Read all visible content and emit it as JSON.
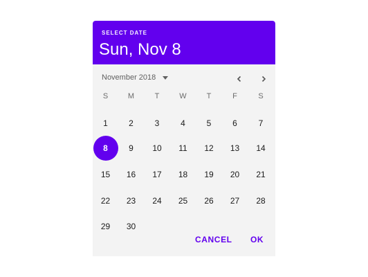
{
  "header": {
    "label": "SELECT DATE",
    "selected_date": "Sun, Nov 8"
  },
  "month": {
    "label": "November 2018"
  },
  "icons": {
    "dropdown": "caret-down-icon",
    "prev": "chevron-left-icon",
    "next": "chevron-right-icon"
  },
  "weekdays": [
    "S",
    "M",
    "T",
    "W",
    "T",
    "F",
    "S"
  ],
  "weeks": [
    [
      "1",
      "2",
      "3",
      "4",
      "5",
      "6",
      "7"
    ],
    [
      "8",
      "9",
      "10",
      "11",
      "12",
      "13",
      "14"
    ],
    [
      "15",
      "16",
      "17",
      "18",
      "19",
      "20",
      "21"
    ],
    [
      "22",
      "23",
      "24",
      "25",
      "26",
      "27",
      "28"
    ],
    [
      "29",
      "30",
      "",
      "",
      "",
      "",
      ""
    ]
  ],
  "selected_day": "8",
  "actions": {
    "cancel": "CANCEL",
    "ok": "OK"
  },
  "colors": {
    "accent": "#6200ee",
    "surface": "#f3f3f3",
    "header_text": "#ffffff"
  }
}
